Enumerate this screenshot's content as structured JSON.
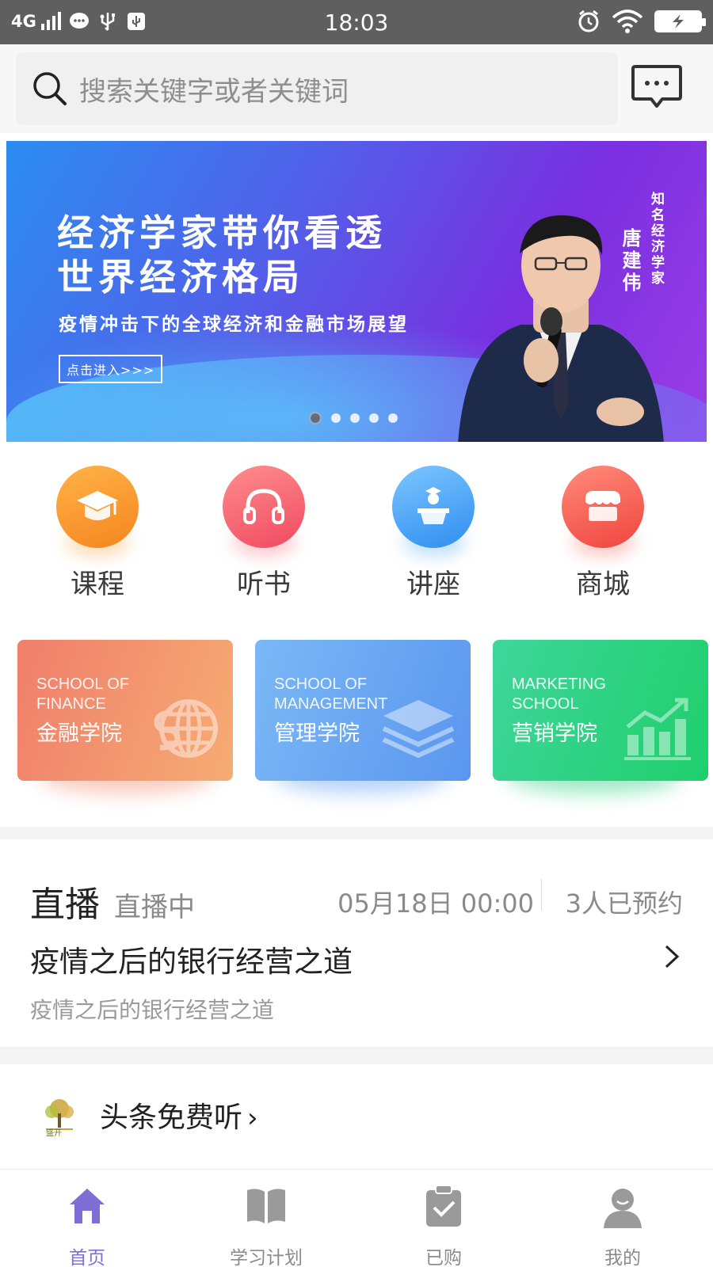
{
  "status_bar": {
    "network": "4G",
    "time": "18:03"
  },
  "search": {
    "placeholder": "搜索关键字或者关键词"
  },
  "banner": {
    "headline_line1": "经济学家带你看透",
    "headline_line2": "世界经济格局",
    "subtitle": "疫情冲击下的全球经济和金融市场展望",
    "cta": "点击进入>>>",
    "person_name": "唐建伟",
    "person_title": "知名经济学家",
    "slide_count": 5,
    "active_slide": 1
  },
  "categories": [
    {
      "label": "课程",
      "icon": "graduation-cap-icon",
      "color": "#f7962c"
    },
    {
      "label": "听书",
      "icon": "headphones-icon",
      "color": "#f45d6e"
    },
    {
      "label": "讲座",
      "icon": "lecture-podium-icon",
      "color": "#3a9cf2"
    },
    {
      "label": "商城",
      "icon": "store-icon",
      "color": "#f5554f"
    }
  ],
  "schools": [
    {
      "en_line1": "SCHOOL OF",
      "en_line2": "FINANCE",
      "cn": "金融学院",
      "icon": "globe-dollar-icon"
    },
    {
      "en_line1": "SCHOOL OF",
      "en_line2": "MANAGEMENT",
      "cn": "管理学院",
      "icon": "layers-icon"
    },
    {
      "en_line1": "MARKETING",
      "en_line2": "SCHOOL",
      "cn": "营销学院",
      "icon": "growth-chart-icon"
    }
  ],
  "live": {
    "title": "直播",
    "status": "直播中",
    "datetime": "05月18日 00:00",
    "reserved": "3人已预约",
    "name": "疫情之后的银行经营之道",
    "description": "疫情之后的银行经营之道"
  },
  "headline": {
    "logo_text": "盛开",
    "title": "头条免费听",
    "arrow": "›"
  },
  "bottom_nav": [
    {
      "label": "首页",
      "icon": "home-icon",
      "active": true
    },
    {
      "label": "学习计划",
      "icon": "book-icon",
      "active": false
    },
    {
      "label": "已购",
      "icon": "clipboard-check-icon",
      "active": false
    },
    {
      "label": "我的",
      "icon": "user-icon",
      "active": false
    }
  ],
  "colors": {
    "accent": "#7e6fd6",
    "status_bar": "#5f5f5f"
  }
}
